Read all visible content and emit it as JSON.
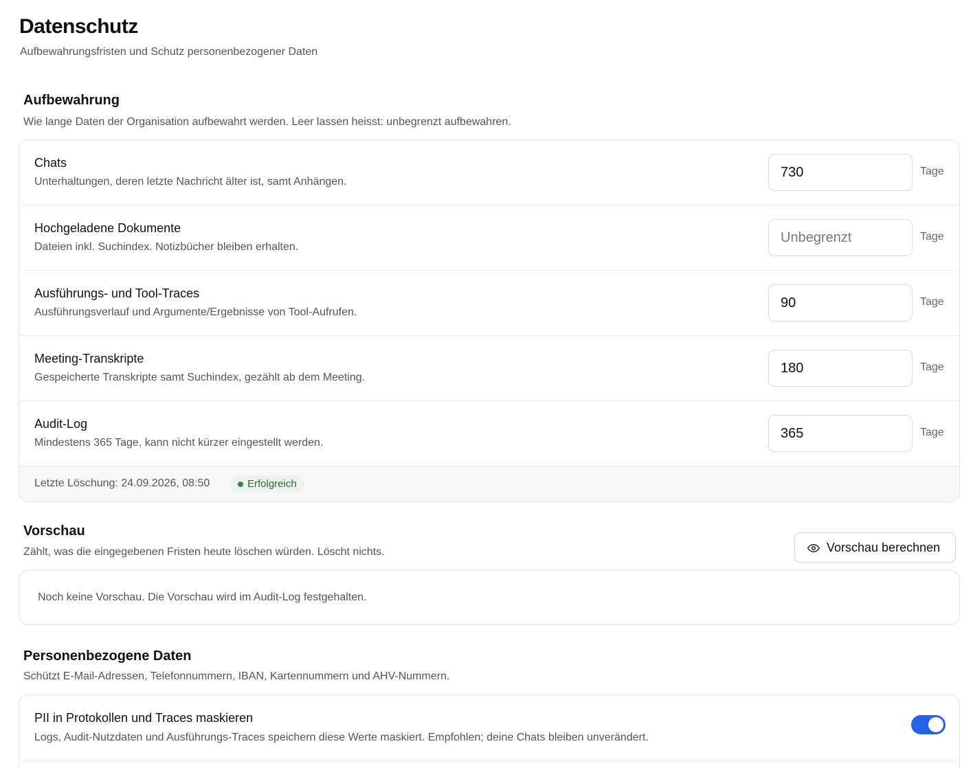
{
  "header": {
    "title": "Datenschutz",
    "subtitle": "Aufbewahrungsfristen und Schutz personenbezogener Daten"
  },
  "retention": {
    "title": "Aufbewahrung",
    "description": "Wie lange Daten der Organisation aufbewahrt werden. Leer lassen heisst: unbegrenzt aufbewahren.",
    "rows": [
      {
        "title": "Chats",
        "description": "Unterhaltungen, deren letzte Nachricht älter ist, samt Anhängen.",
        "value": "730",
        "placeholder": "Unbegrenzt",
        "unit": "Tage"
      },
      {
        "title": "Hochgeladene Dokumente",
        "description": "Dateien inkl. Suchindex. Notizbücher bleiben erhalten.",
        "value": "",
        "placeholder": "Unbegrenzt",
        "unit": "Tage"
      },
      {
        "title": "Ausführungs- und Tool-Traces",
        "description": "Ausführungsverlauf und Argumente/Ergebnisse von Tool-Aufrufen.",
        "value": "90",
        "placeholder": "Unbegrenzt",
        "unit": "Tage"
      },
      {
        "title": "Meeting-Transkripte",
        "description": "Gespeicherte Transkripte samt Suchindex, gezählt ab dem Meeting.",
        "value": "180",
        "placeholder": "Unbegrenzt",
        "unit": "Tage"
      },
      {
        "title": "Audit-Log",
        "description": "Mindestens 365 Tage, kann nicht kürzer eingestellt werden.",
        "value": "365",
        "placeholder": "Unbegrenzt",
        "unit": "Tage"
      }
    ],
    "last_deletion": "Letzte Löschung: 24.09.2026, 08:50",
    "status_badge": "Erfolgreich"
  },
  "preview": {
    "title": "Vorschau",
    "description": "Zählt, was die eingegebenen Fristen heute löschen würden. Löscht nichts.",
    "button_label": "Vorschau berechnen",
    "button_icon": "eye-icon",
    "empty_text": "Noch keine Vorschau. Die Vorschau wird im Audit-Log festgehalten."
  },
  "pii": {
    "title": "Personenbezogene Daten",
    "description": "Schützt E-Mail-Adressen, Telefonnummern, IBAN, Kartennummern und AHV-Nummern.",
    "setting_title": "PII in Protokollen und Traces maskieren",
    "setting_description": "Logs, Audit-Nutzdaten und Ausführungs-Traces speichern diese Werte maskiert. Empfohlen; deine Chats bleiben unverändert.",
    "toggle_on": true
  },
  "colors": {
    "accent": "#2563eb",
    "success": "#2e8b3a",
    "success_text": "#2b6b33"
  }
}
